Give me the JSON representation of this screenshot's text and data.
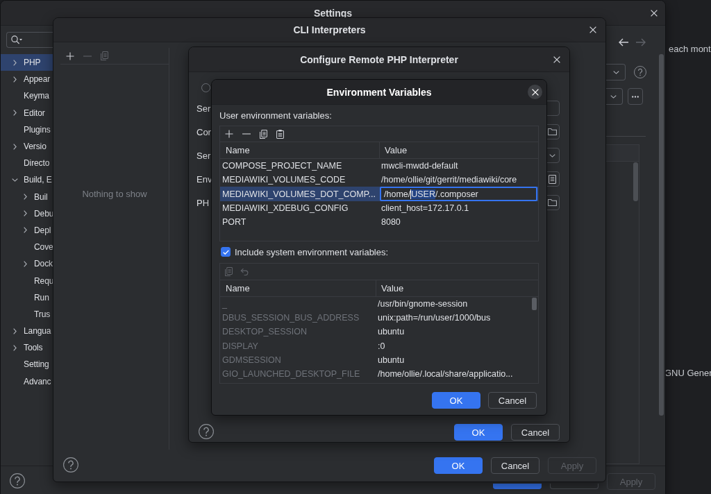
{
  "background_window": {
    "texts": [
      "each mont",
      "GNU Gener"
    ]
  },
  "settings": {
    "title": "Settings",
    "sidebar": {
      "items": [
        {
          "label": "PHP",
          "kind": "group",
          "expanded": false,
          "selected": true
        },
        {
          "label": "Appear",
          "kind": "group",
          "expanded": false,
          "selected": false
        },
        {
          "label": "Keyma",
          "kind": "leaf",
          "expanded": false,
          "selected": false
        },
        {
          "label": "Editor",
          "kind": "group",
          "expanded": false,
          "selected": false
        },
        {
          "label": "Plugins",
          "kind": "leaf",
          "expanded": false,
          "selected": false
        },
        {
          "label": "Versio",
          "kind": "group",
          "expanded": false,
          "selected": false
        },
        {
          "label": "Directo",
          "kind": "leaf",
          "expanded": false,
          "selected": false
        },
        {
          "label": "Build, E",
          "kind": "group",
          "expanded": true,
          "selected": false,
          "children": [
            {
              "label": "Buil",
              "kind": "group",
              "expanded": false,
              "selected": false
            },
            {
              "label": "Debu",
              "kind": "group",
              "expanded": false,
              "selected": false
            },
            {
              "label": "Depl",
              "kind": "group",
              "expanded": false,
              "selected": false
            },
            {
              "label": "Cove",
              "kind": "leaf",
              "expanded": false,
              "selected": false
            },
            {
              "label": "Dock",
              "kind": "group",
              "expanded": false,
              "selected": false
            },
            {
              "label": "Requ",
              "kind": "leaf",
              "expanded": false,
              "selected": false
            },
            {
              "label": "Run",
              "kind": "leaf",
              "expanded": false,
              "selected": false
            },
            {
              "label": "Trus",
              "kind": "leaf",
              "expanded": false,
              "selected": false
            }
          ]
        },
        {
          "label": "Langua",
          "kind": "group",
          "expanded": false,
          "selected": false
        },
        {
          "label": "Tools",
          "kind": "group",
          "expanded": false,
          "selected": false
        },
        {
          "label": "Setting",
          "kind": "leaf",
          "expanded": false,
          "selected": false
        },
        {
          "label": "Advanc",
          "kind": "leaf",
          "expanded": false,
          "selected": false
        }
      ]
    },
    "navigation": [
      {
        "kind": "back",
        "disabled": false
      },
      {
        "kind": "forward",
        "disabled": true
      }
    ],
    "footer_buttons": [
      {
        "kind": "primary",
        "disabled": false
      },
      {
        "kind": "secondary",
        "disabled": false
      },
      {
        "kind": "secondary",
        "label": "Apply",
        "disabled": true
      }
    ]
  },
  "cli_interpreters": {
    "title": "CLI Interpreters",
    "toolbar": [
      {
        "kind": "add",
        "disabled": false
      },
      {
        "kind": "remove",
        "disabled": true
      },
      {
        "kind": "copy",
        "disabled": true
      }
    ],
    "empty_text": "Nothing to show",
    "buttons": [
      {
        "label": "OK",
        "kind": "primary",
        "disabled": false
      },
      {
        "label": "Cancel",
        "kind": "secondary",
        "disabled": false
      },
      {
        "label": "Apply",
        "kind": "secondary",
        "disabled": true
      }
    ]
  },
  "configure_remote_interpreter": {
    "title": "Configure Remote PHP Interpreter",
    "radio": {
      "selected": false
    },
    "fields": [
      {
        "label": "Ser",
        "kind": "browse"
      },
      {
        "label": "Cor",
        "kind": "folder"
      },
      {
        "label": "Ser",
        "kind": "dropdown"
      },
      {
        "label": "Env",
        "kind": "document"
      },
      {
        "label": "PH",
        "kind": "folder"
      }
    ],
    "buttons": [
      {
        "label": "OK",
        "kind": "primary"
      },
      {
        "label": "Cancel",
        "kind": "secondary"
      }
    ]
  },
  "environment_variables": {
    "title": "Environment Variables",
    "user_label": "User environment variables:",
    "user_table": {
      "toolbar": [
        {
          "kind": "add",
          "disabled": false
        },
        {
          "kind": "remove",
          "disabled": false
        },
        {
          "kind": "copy",
          "disabled": false
        },
        {
          "kind": "paste",
          "disabled": false
        }
      ],
      "columns": [
        "Name",
        "Value"
      ],
      "rows": [
        {
          "name": "COMPOSE_PROJECT_NAME",
          "value": "mwcli-mwdd-default",
          "selected": false,
          "editing": false
        },
        {
          "name": "MEDIAWIKI_VOLUMES_CODE",
          "value": "/home/ollie/git/gerrit/mediawiki/core",
          "selected": false,
          "editing": false
        },
        {
          "name": "MEDIAWIKI_VOLUMES_DOT_COMP...",
          "value_parts": [
            {
              "text": "/home/",
              "highlighted": false
            },
            {
              "text": "USER",
              "highlighted": true
            },
            {
              "text": "/.composer",
              "highlighted": false
            }
          ],
          "selected": true,
          "editing": true
        },
        {
          "name": "MEDIAWIKI_XDEBUG_CONFIG",
          "value": "client_host=172.17.0.1",
          "selected": false,
          "editing": false
        },
        {
          "name": "PORT",
          "value": "8080",
          "selected": false,
          "editing": false
        }
      ]
    },
    "include_system": {
      "label": "Include system environment variables:",
      "checked": true
    },
    "system_table": {
      "toolbar": [
        {
          "kind": "copy",
          "disabled": true
        },
        {
          "kind": "undo",
          "disabled": true
        }
      ],
      "columns": [
        "Name",
        "Value"
      ],
      "rows": [
        {
          "name": "_",
          "value": "/usr/bin/gnome-session"
        },
        {
          "name": "DBUS_SESSION_BUS_ADDRESS",
          "value": "unix:path=/run/user/1000/bus"
        },
        {
          "name": "DESKTOP_SESSION",
          "value": "ubuntu"
        },
        {
          "name": "DISPLAY",
          "value": ":0"
        },
        {
          "name": "GDMSESSION",
          "value": "ubuntu"
        },
        {
          "name": "GIO_LAUNCHED_DESKTOP_FILE",
          "value": "/home/ollie/.local/share/applicatio..."
        }
      ]
    },
    "buttons": [
      {
        "label": "OK",
        "kind": "primary"
      },
      {
        "label": "Cancel",
        "kind": "secondary"
      }
    ]
  }
}
